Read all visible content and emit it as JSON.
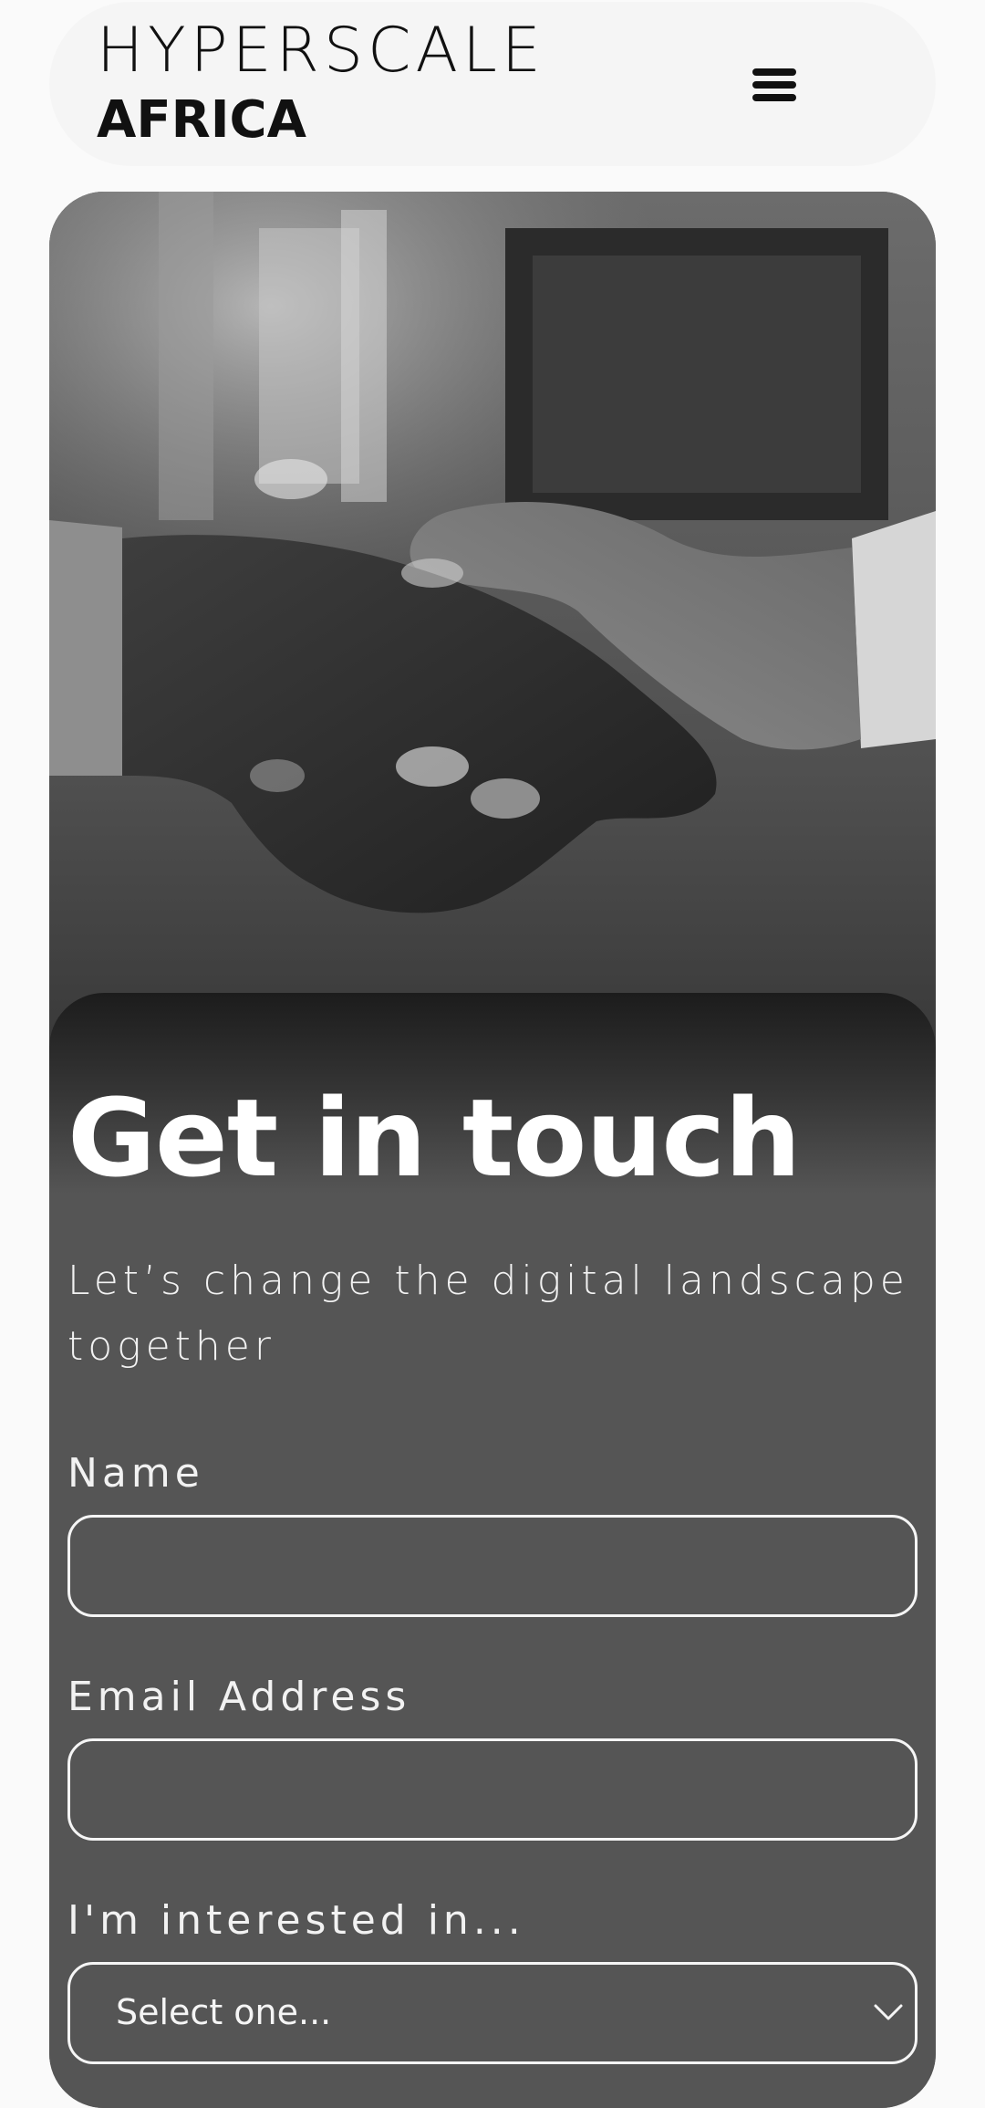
{
  "header": {
    "logo_top": "HYPERSCALE",
    "logo_bottom": "AFRICA",
    "menu_icon": "hamburger-menu-icon"
  },
  "hero": {
    "image": "handshake-photo"
  },
  "form": {
    "title": "Get in touch",
    "subtitle": "Let’s change the digital landscape together",
    "name_label": "Name",
    "name_value": "",
    "email_label": "Email Address",
    "email_value": "",
    "interest_label": "I'm interested in...",
    "interest_selected": "Select one...",
    "interest_icon": "chevron-down-icon"
  },
  "colors": {
    "page_background": "#fafafa",
    "header_background": "#f5f5f5",
    "panel_background": "#555555",
    "text_light": "#f2f2f2",
    "logo_text": "#111111"
  }
}
